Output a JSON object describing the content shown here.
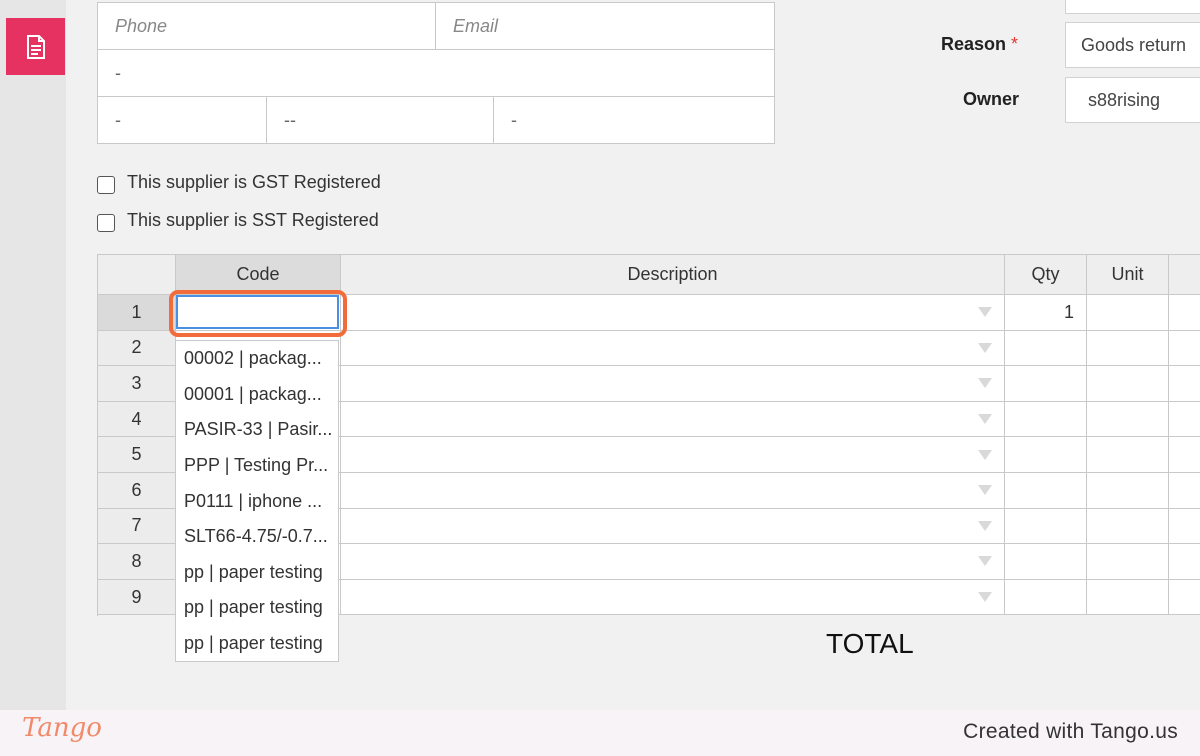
{
  "contact": {
    "phone_placeholder": "Phone",
    "email_placeholder": "Email",
    "address_line": "-",
    "city": "-",
    "state": "--",
    "postcode": "-"
  },
  "form": {
    "reason_label": "Reason",
    "reason_required": "*",
    "reason_value": "Goods return",
    "owner_label": "Owner",
    "owner_value": "s88rising"
  },
  "checkboxes": {
    "gst": "This supplier is GST Registered",
    "sst": "This supplier is SST Registered"
  },
  "grid": {
    "columns": [
      "Code",
      "Description",
      "Qty",
      "Unit"
    ],
    "rows": [
      "1",
      "2",
      "3",
      "4",
      "5",
      "6",
      "7",
      "8",
      "9"
    ],
    "row1_qty": "1"
  },
  "dropdown": {
    "items": [
      "00002 | packag...",
      "00001 | packag...",
      "PASIR-33 | Pasir...",
      "PPP | Testing Pr...",
      "P0111 | iphone ...",
      "SLT66-4.75/-0.7...",
      "pp | paper testing",
      "pp | paper testing",
      "pp | paper testing"
    ]
  },
  "total_label": "TOTAL",
  "footer": {
    "logo": "Tango",
    "credit": "Created with Tango.us"
  },
  "colors": {
    "accent": "#e53261",
    "highlight": "#f26b3a",
    "focus": "#4a90e2"
  }
}
